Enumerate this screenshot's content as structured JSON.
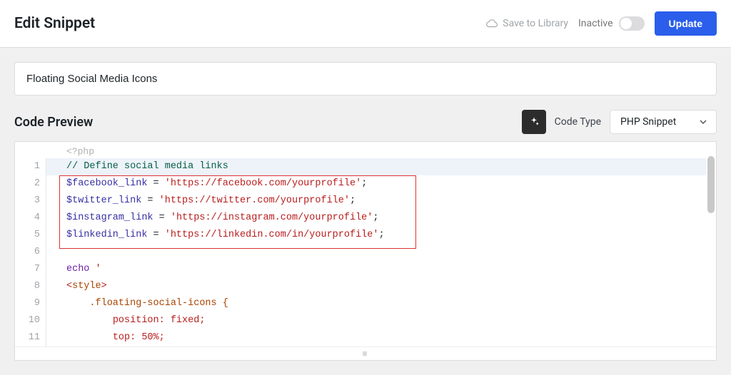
{
  "header": {
    "title": "Edit Snippet",
    "save_to_library": "Save to Library",
    "inactive_label": "Inactive",
    "update_button": "Update"
  },
  "snippet": {
    "title": "Floating Social Media Icons"
  },
  "code_panel": {
    "preview_label": "Code Preview",
    "code_type_label": "Code Type",
    "code_type_value": "PHP Snippet"
  },
  "editor": {
    "opening_tag": "<?php",
    "line_numbers": [
      "1",
      "2",
      "3",
      "4",
      "5",
      "6",
      "7",
      "8",
      "9",
      "10",
      "11"
    ],
    "lines": {
      "l1_comment": "// Define social media links",
      "l2_var": "$facebook_link",
      "l2_str": "'https://facebook.com/yourprofile'",
      "l3_var": "$twitter_link",
      "l3_str": "'https://twitter.com/yourprofile'",
      "l4_var": "$instagram_link",
      "l4_str": "'https://instagram.com/yourprofile'",
      "l5_var": "$linkedin_link",
      "l5_str": "'https://linkedin.com/in/yourprofile'",
      "l7_echo": "echo ",
      "l7_quote": "'",
      "l8_tag_open": "<",
      "l8_tag_name": "style",
      "l8_tag_close": ">",
      "l9_selector": ".floating-social-icons {",
      "l10_prop": "position",
      "l10_val": ": fixed;",
      "l11_prop": "top",
      "l11_val": ": 50%;"
    },
    "drag_handle": "≡"
  }
}
